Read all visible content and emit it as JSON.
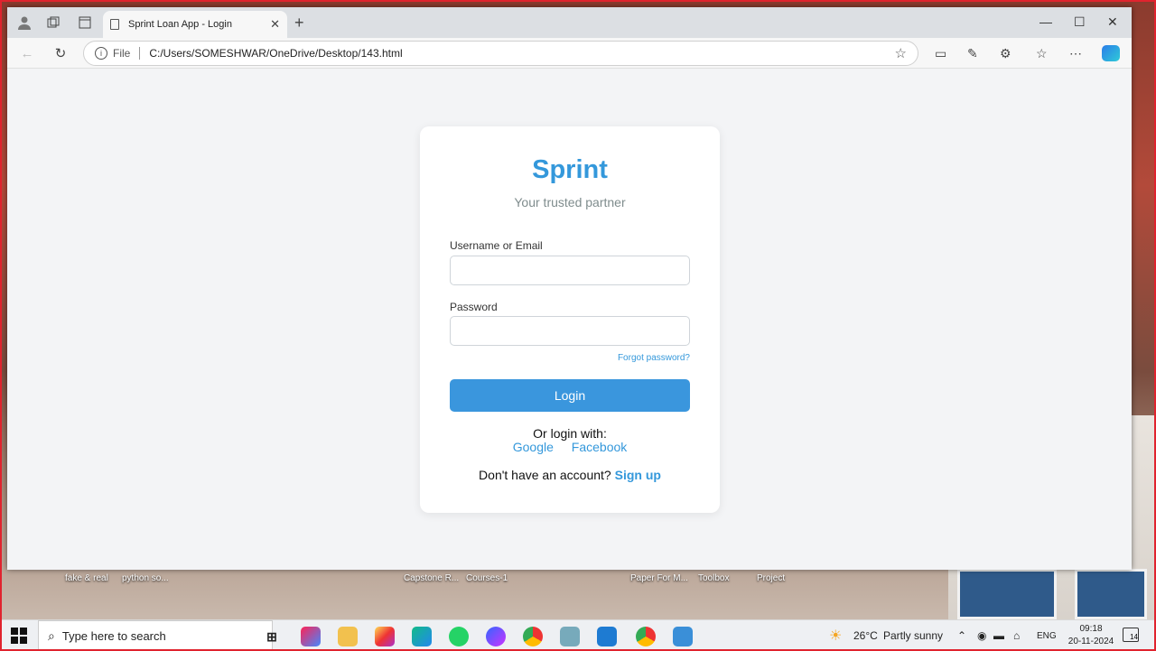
{
  "browser": {
    "tab_title": "Sprint Loan App - Login",
    "address_scheme": "File",
    "address_url": "C:/Users/SOMESHWAR/OneDrive/Desktop/143.html"
  },
  "login": {
    "brand": "Sprint",
    "tagline": "Your trusted partner",
    "username_label": "Username or Email",
    "username_value": "",
    "password_label": "Password",
    "password_value": "",
    "forgot_link": "Forgot password?",
    "login_button": "Login",
    "or_login_with": "Or login with:",
    "google_link": "Google",
    "facebook_link": "Facebook",
    "no_account_text": "Don't have an account?",
    "signup_link": "Sign up",
    "accent_color": "#3498db"
  },
  "desktop": {
    "labels": [
      "fake & real",
      "python so...",
      "Capstone R...",
      "Courses-1",
      "Paper For M...",
      "Toolbox",
      "Project"
    ]
  },
  "taskbar": {
    "search_placeholder": "Type here to search",
    "weather_temp": "26°C",
    "weather_text": "Partly sunny",
    "language": "ENG",
    "time": "09:18",
    "date": "20-11-2024",
    "notification_count": "14"
  }
}
